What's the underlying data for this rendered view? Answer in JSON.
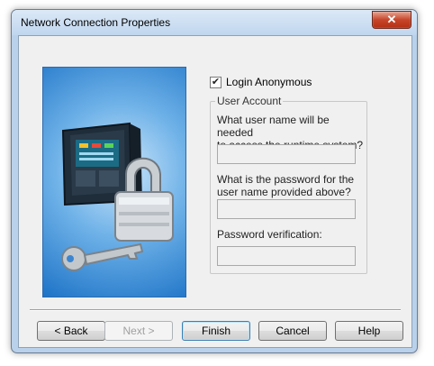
{
  "window": {
    "title": "Network Connection Properties",
    "close_glyph": "✕"
  },
  "illustration": {
    "icon": "network-lock-key-illustration"
  },
  "login": {
    "checked": true,
    "check_glyph": "✔",
    "label": "Login Anonymous"
  },
  "account": {
    "group_title": "User Account",
    "username_question_line1": "What user name will be needed",
    "username_question_line2": "to access the runtime system?",
    "username_value": "",
    "password_question_line1": "What is the password for the",
    "password_question_line2": "user name provided above?",
    "password_value": "",
    "verify_label": "Password verification:",
    "verify_value": ""
  },
  "buttons": {
    "back": "< Back",
    "next": "Next >",
    "finish": "Finish",
    "cancel": "Cancel",
    "help": "Help"
  }
}
